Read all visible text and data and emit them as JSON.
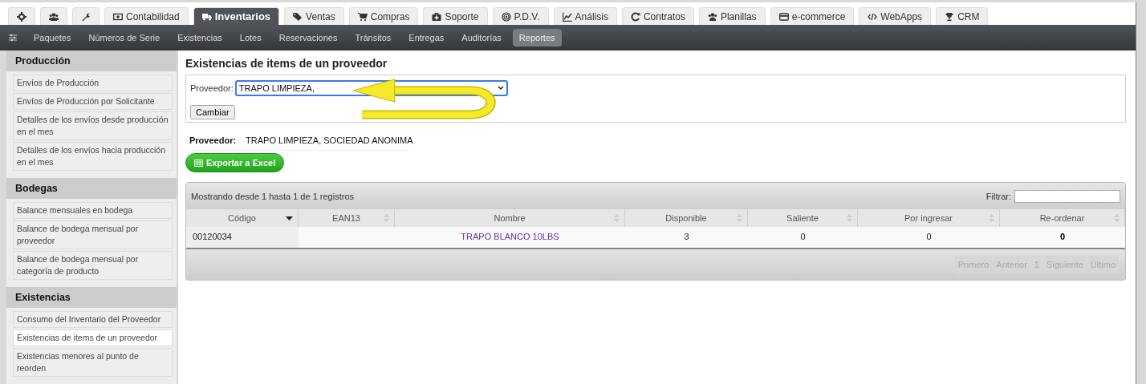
{
  "top_tabs": [
    {
      "kind": "icon",
      "selected": false
    },
    {
      "kind": "icon",
      "selected": false
    },
    {
      "kind": "icon",
      "selected": false
    },
    {
      "kind": "label",
      "label": "Contabilidad",
      "selected": false
    },
    {
      "kind": "label",
      "label": "Inventarios",
      "selected": true
    },
    {
      "kind": "label",
      "label": "Ventas",
      "selected": false
    },
    {
      "kind": "label",
      "label": "Compras",
      "selected": false
    },
    {
      "kind": "label",
      "label": "Soporte",
      "selected": false
    },
    {
      "kind": "label",
      "label": "P.D.V.",
      "selected": false
    },
    {
      "kind": "label",
      "label": "Análisis",
      "selected": false
    },
    {
      "kind": "label",
      "label": "Contratos",
      "selected": false
    },
    {
      "kind": "label",
      "label": "Planillas",
      "selected": false
    },
    {
      "kind": "label",
      "label": "e-commerce",
      "selected": false
    },
    {
      "kind": "label",
      "label": "WebApps",
      "selected": false
    },
    {
      "kind": "label",
      "label": "CRM",
      "selected": false
    }
  ],
  "sub_nav": [
    {
      "label": "Paquetes",
      "selected": false
    },
    {
      "label": "Números de Serie",
      "selected": false
    },
    {
      "label": "Existencias",
      "selected": false
    },
    {
      "label": "Lotes",
      "selected": false
    },
    {
      "label": "Reservaciones",
      "selected": false
    },
    {
      "label": "Tránsitos",
      "selected": false
    },
    {
      "label": "Entregas",
      "selected": false
    },
    {
      "label": "Auditorías",
      "selected": false
    },
    {
      "label": "Reportes",
      "selected": true
    }
  ],
  "sidebar": [
    {
      "title": "Producción",
      "items": [
        {
          "label": "Envíos de Producción",
          "selected": false
        },
        {
          "label": "Envíos de Producción por Solicitante",
          "selected": false
        },
        {
          "label": "Detalles de los envíos desde producción en el mes",
          "selected": false
        },
        {
          "label": "Detalles de los envíos hacia producción en el mes",
          "selected": false
        }
      ]
    },
    {
      "title": "Bodegas",
      "items": [
        {
          "label": "Balance mensuales en bodega",
          "selected": false
        },
        {
          "label": "Balance de bodega mensual por proveedor",
          "selected": false
        },
        {
          "label": "Balance de bodega mensual por categoría de producto",
          "selected": false
        }
      ]
    },
    {
      "title": "Existencias",
      "items": [
        {
          "label": "Consumo del Inventario del Proveedor",
          "selected": false
        },
        {
          "label": "Existencias de items de un proveedor",
          "selected": true
        },
        {
          "label": "Existencias menores al punto de reorden",
          "selected": false
        }
      ]
    }
  ],
  "page_title": "Existencias de items de un proveedor",
  "form": {
    "label": "Proveedor:",
    "value": "TRAPO LIMPIEZA,",
    "button": "Cambiar"
  },
  "provider": {
    "label": "Proveedor:",
    "value": "TRAPO LIMPIEZA, SOCIEDAD ANONIMA"
  },
  "export_button": "Exportar a Excel",
  "table": {
    "info": "Mostrando desde 1 hasta 1 de 1 registros",
    "filter_label": "Filtrar:",
    "columns": [
      {
        "label": "Código",
        "sorted": true,
        "kind": "plain"
      },
      {
        "label": "EAN13",
        "sorted": false,
        "kind": "plain"
      },
      {
        "label": "Nombre",
        "sorted": false,
        "kind": "link"
      },
      {
        "label": "Disponible",
        "sorted": false,
        "kind": "plain"
      },
      {
        "label": "Saliente",
        "sorted": false,
        "kind": "plain"
      },
      {
        "label": "Por ingresar",
        "sorted": false,
        "kind": "plain"
      },
      {
        "label": "Re-ordenar",
        "sorted": false,
        "kind": "bold"
      }
    ],
    "rows": [
      [
        "00120034",
        "",
        "TRAPO BLANCO 10LBS",
        "3",
        "0",
        "0",
        "0"
      ]
    ],
    "pagination": [
      {
        "label": "Primero",
        "disabled": true
      },
      {
        "label": "Anterior",
        "disabled": true
      },
      {
        "label": "1",
        "disabled": true
      },
      {
        "label": "Siguiente",
        "disabled": true
      },
      {
        "label": "Último",
        "disabled": true
      }
    ]
  }
}
